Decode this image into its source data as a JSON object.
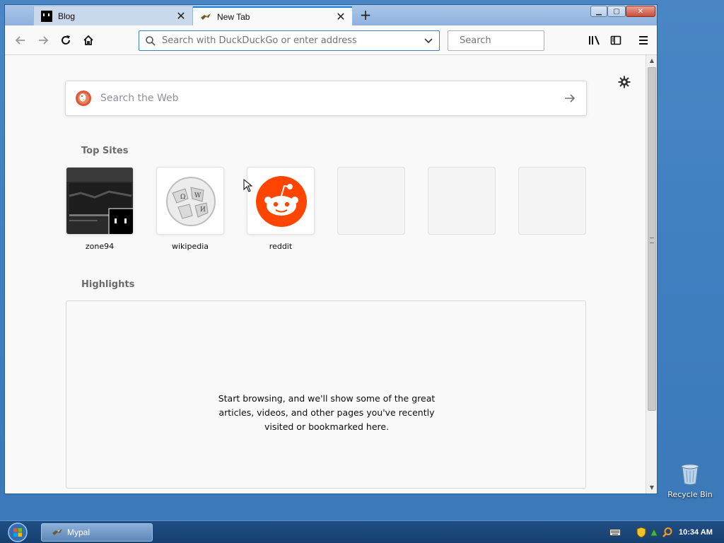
{
  "browser": {
    "tabs": [
      {
        "label": "Blog",
        "active": false
      },
      {
        "label": "New Tab",
        "active": true
      }
    ],
    "close_glyph": "✕",
    "new_tab_glyph": "+",
    "window_controls": {
      "minimize": "▁",
      "maximize": "▢",
      "close": "✕"
    }
  },
  "toolbar": {
    "url_placeholder": "Search with DuckDuckGo or enter address",
    "search_placeholder": "Search",
    "icons": [
      "back-arrow-icon",
      "forward-arrow-icon",
      "reload-icon",
      "home-icon",
      "library-icon",
      "sidebar-icon",
      "hamburger-menu-icon"
    ]
  },
  "newtab": {
    "search_placeholder": "Search the Web",
    "top_sites_title": "Top Sites",
    "top_sites": [
      {
        "label": "zone94"
      },
      {
        "label": "wikipedia"
      },
      {
        "label": "reddit"
      },
      {
        "label": ""
      },
      {
        "label": ""
      },
      {
        "label": ""
      }
    ],
    "highlights_title": "Highlights",
    "highlights_empty": "Start browsing, and we'll show some of the great articles, videos, and other pages you've recently visited or bookmarked here."
  },
  "desktop": {
    "recycle_bin_label": "Recycle Bin"
  },
  "taskbar": {
    "app_label": "Mypal",
    "clock": "10:34 AM"
  },
  "colors": {
    "accent": "#0a84ff",
    "reddit": "#ff4500",
    "desktop": "#3f7fc0"
  }
}
